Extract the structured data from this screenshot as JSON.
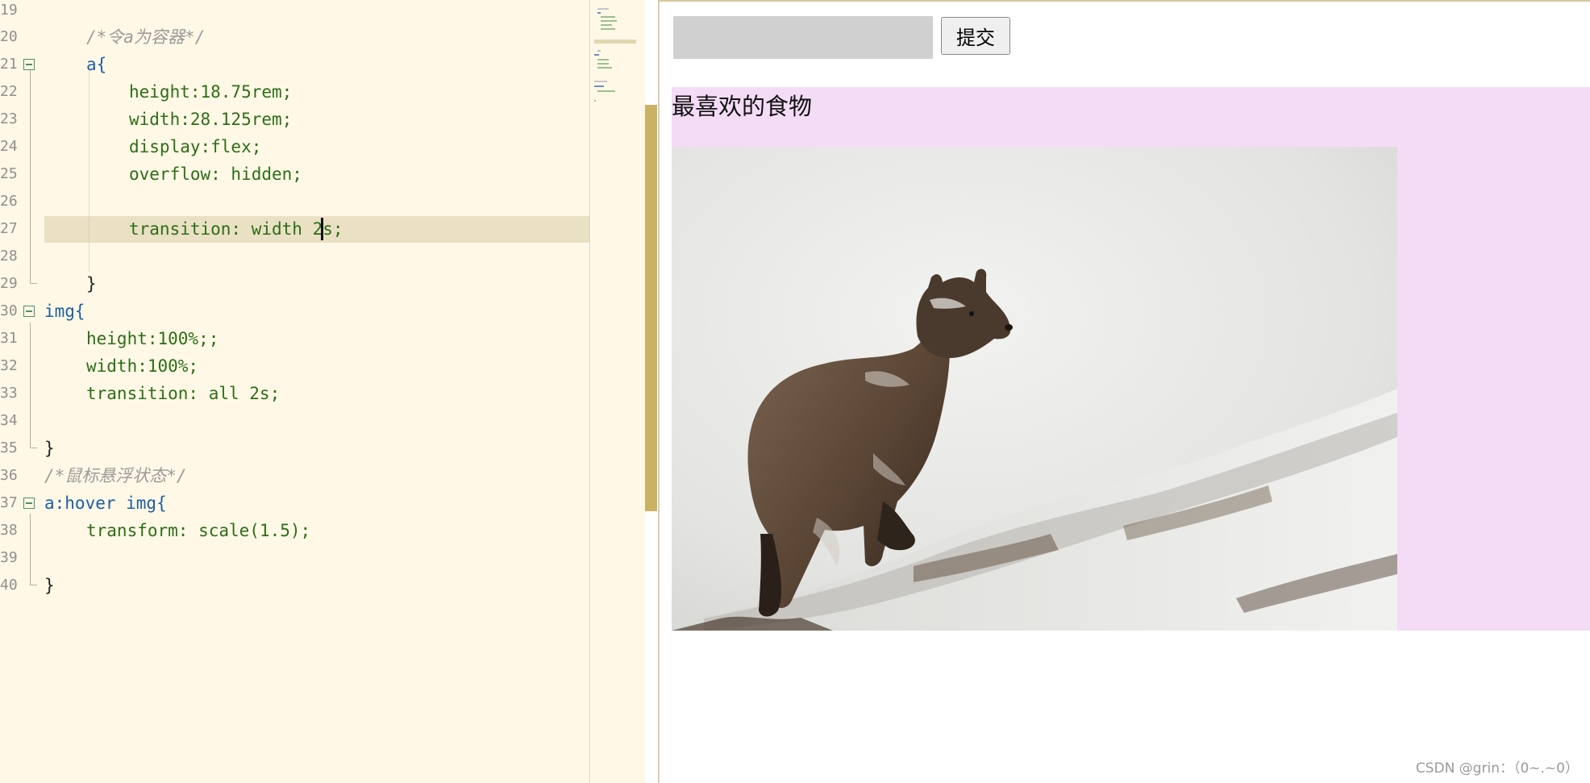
{
  "editor": {
    "lines": [
      {
        "n": "19",
        "text": ""
      },
      {
        "n": "20",
        "text": "/*令a为容器*/"
      },
      {
        "n": "21",
        "text": "a{"
      },
      {
        "n": "22",
        "text": "height:18.75rem;"
      },
      {
        "n": "23",
        "text": "width:28.125rem;"
      },
      {
        "n": "24",
        "text": "display:flex;"
      },
      {
        "n": "25",
        "text": "overflow: hidden;"
      },
      {
        "n": "26",
        "text": ""
      },
      {
        "n": "27",
        "text": "transition: width 2s;"
      },
      {
        "n": "28",
        "text": ""
      },
      {
        "n": "29",
        "text": "}"
      },
      {
        "n": "30",
        "text": "img{"
      },
      {
        "n": "31",
        "text": "height:100%;;"
      },
      {
        "n": "32",
        "text": "width:100%;"
      },
      {
        "n": "33",
        "text": "transition: all 2s;"
      },
      {
        "n": "34",
        "text": ""
      },
      {
        "n": "35",
        "text": "}"
      },
      {
        "n": "36",
        "text": "/*鼠标悬浮状态*/"
      },
      {
        "n": "37",
        "text": "a:hover img{"
      },
      {
        "n": "38",
        "text": "transform: scale(1.5);"
      },
      {
        "n": "39",
        "text": ""
      },
      {
        "n": "40",
        "text": "}"
      }
    ],
    "current_line": "27",
    "colors": {
      "background": "#fff8e6",
      "current_line_highlight": "#eae0c4",
      "selector": "#1d5ea8",
      "property": "#2c6e17",
      "number": "#c2185b",
      "comment": "#9a9a9a",
      "minimap_viewport": "#c9b264"
    }
  },
  "preview": {
    "search": {
      "value": "",
      "placeholder": ""
    },
    "submit_label": "提交",
    "food_title": "最喜欢的食物",
    "image_subject": "bear-in-snow",
    "box_color": "#f4dbf6",
    "watermark": "CSDN @grin：（0~.~0）"
  }
}
